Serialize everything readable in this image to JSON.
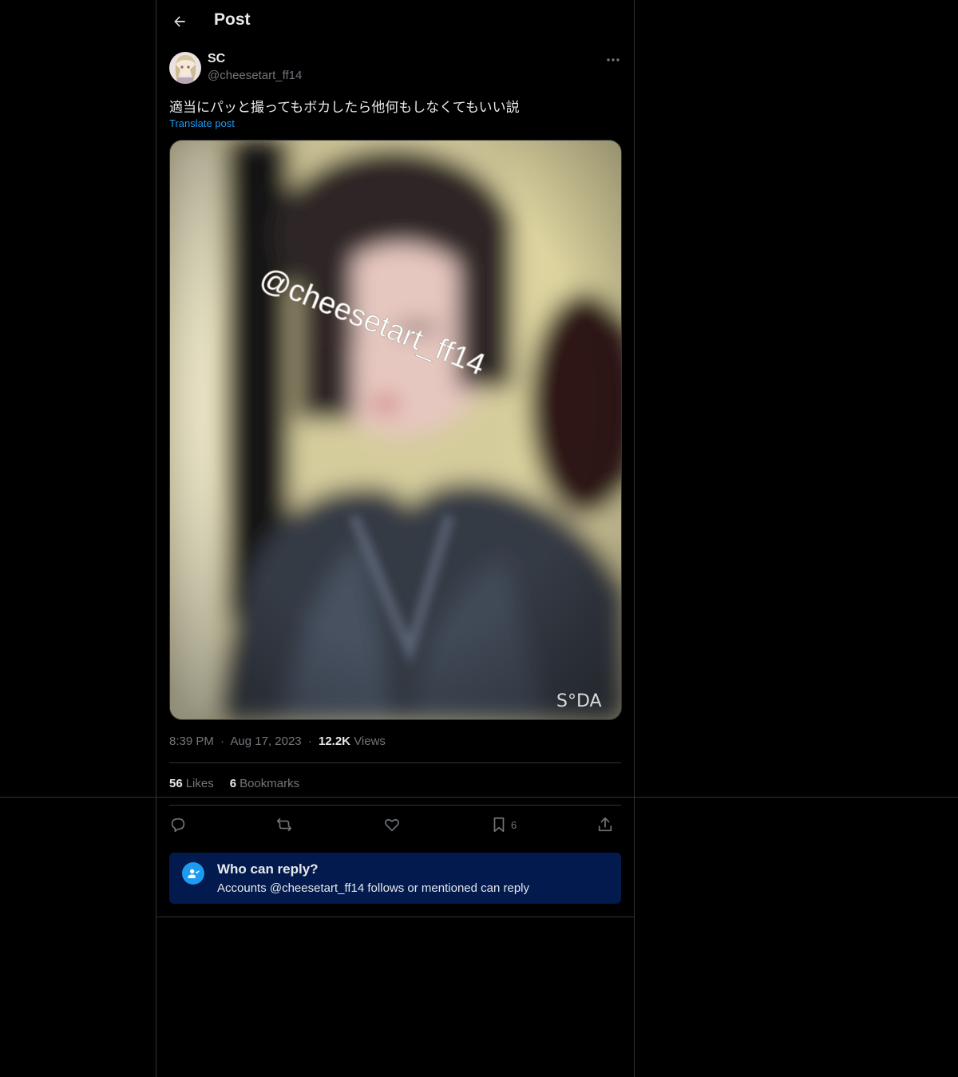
{
  "header": {
    "title": "Post"
  },
  "post": {
    "author": {
      "display_name": "SC",
      "handle": "@cheesetart_ff14"
    },
    "text": "適当にパッと撮ってもボカしたら他何もしなくてもいい説",
    "translate_label": "Translate post",
    "media": {
      "watermark": "@cheesetart_ff14",
      "app_logo": "S°DA"
    },
    "meta": {
      "time": "8:39 PM",
      "dot": "·",
      "date": "Aug 17, 2023",
      "views_count": "12.2K",
      "views_label": "Views"
    },
    "stats": {
      "likes_count": "56",
      "likes_label": "Likes",
      "bookmarks_count": "6",
      "bookmarks_label": "Bookmarks"
    },
    "actions": {
      "bookmark_count": "6"
    }
  },
  "reply_restriction": {
    "title": "Who can reply?",
    "description": "Accounts @cheesetart_ff14 follows or mentioned can reply"
  },
  "colors": {
    "accent": "#1d9bf0",
    "background": "#000000",
    "muted": "#71767b",
    "reply_box": "#031a4e"
  }
}
